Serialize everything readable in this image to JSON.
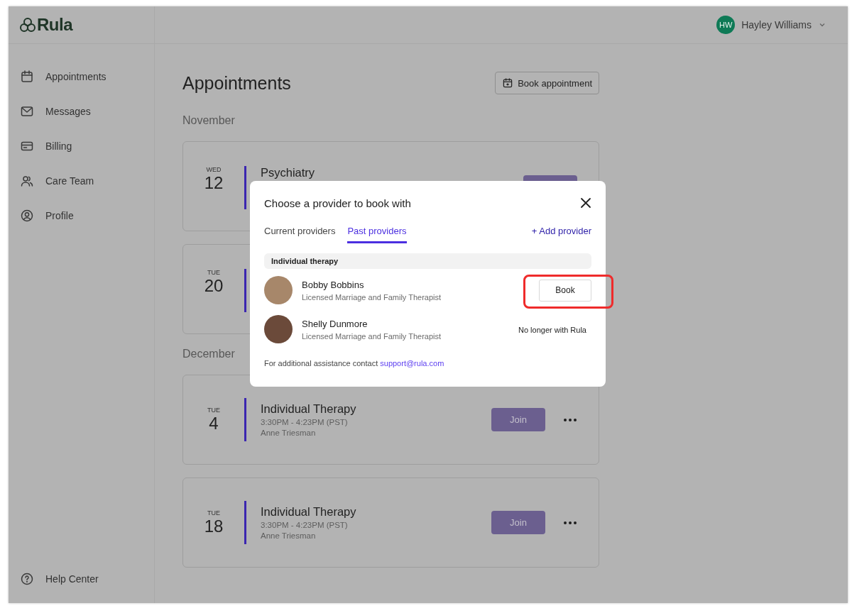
{
  "app": {
    "logo": "Rula"
  },
  "user": {
    "initials": "HW",
    "name": "Hayley Williams"
  },
  "sidebar": {
    "items": [
      {
        "label": "Appointments"
      },
      {
        "label": "Messages"
      },
      {
        "label": "Billing"
      },
      {
        "label": "Care Team"
      },
      {
        "label": "Profile"
      }
    ],
    "footer": {
      "label": "Help Center"
    }
  },
  "page": {
    "title": "Appointments",
    "book_button": "Book appointment"
  },
  "months": [
    {
      "name": "November",
      "appointments": [
        {
          "weekday": "WED",
          "day": "12",
          "title": "Psychiatry",
          "button": true,
          "menu": false
        },
        {
          "weekday": "TUE",
          "day": "20",
          "button": false,
          "menu": false
        }
      ]
    },
    {
      "name": "December",
      "appointments": [
        {
          "weekday": "TUE",
          "day": "4",
          "title": "Individual Therapy",
          "time": "3:30PM - 4:23PM (PST)",
          "provider": "Anne Triesman",
          "action": "Join",
          "button": true,
          "menu": true
        },
        {
          "weekday": "TUE",
          "day": "18",
          "title": "Individual Therapy",
          "time": "3:30PM - 4:23PM (PST)",
          "provider": "Anne Triesman",
          "action": "Join",
          "button": true,
          "menu": true
        }
      ]
    }
  ],
  "modal": {
    "title": "Choose a provider to book with",
    "tabs": [
      {
        "label": "Current providers",
        "selected": false
      },
      {
        "label": "Past providers",
        "selected": true
      }
    ],
    "add_link": "+ Add provider",
    "section": "Individual therapy",
    "providers": [
      {
        "name": "Bobby Bobbins",
        "role": "Licensed Marriage and Family Therapist",
        "kind": "book",
        "action": "Book",
        "highlighted": true
      },
      {
        "name": "Shelly Dunmore",
        "role": "Licensed Marriage and Family Therapist",
        "kind": "status",
        "status": "No longer with Rula",
        "highlighted": false
      }
    ],
    "footer": {
      "text": "For additional assistance contact",
      "link": "support@rula.com"
    }
  }
}
